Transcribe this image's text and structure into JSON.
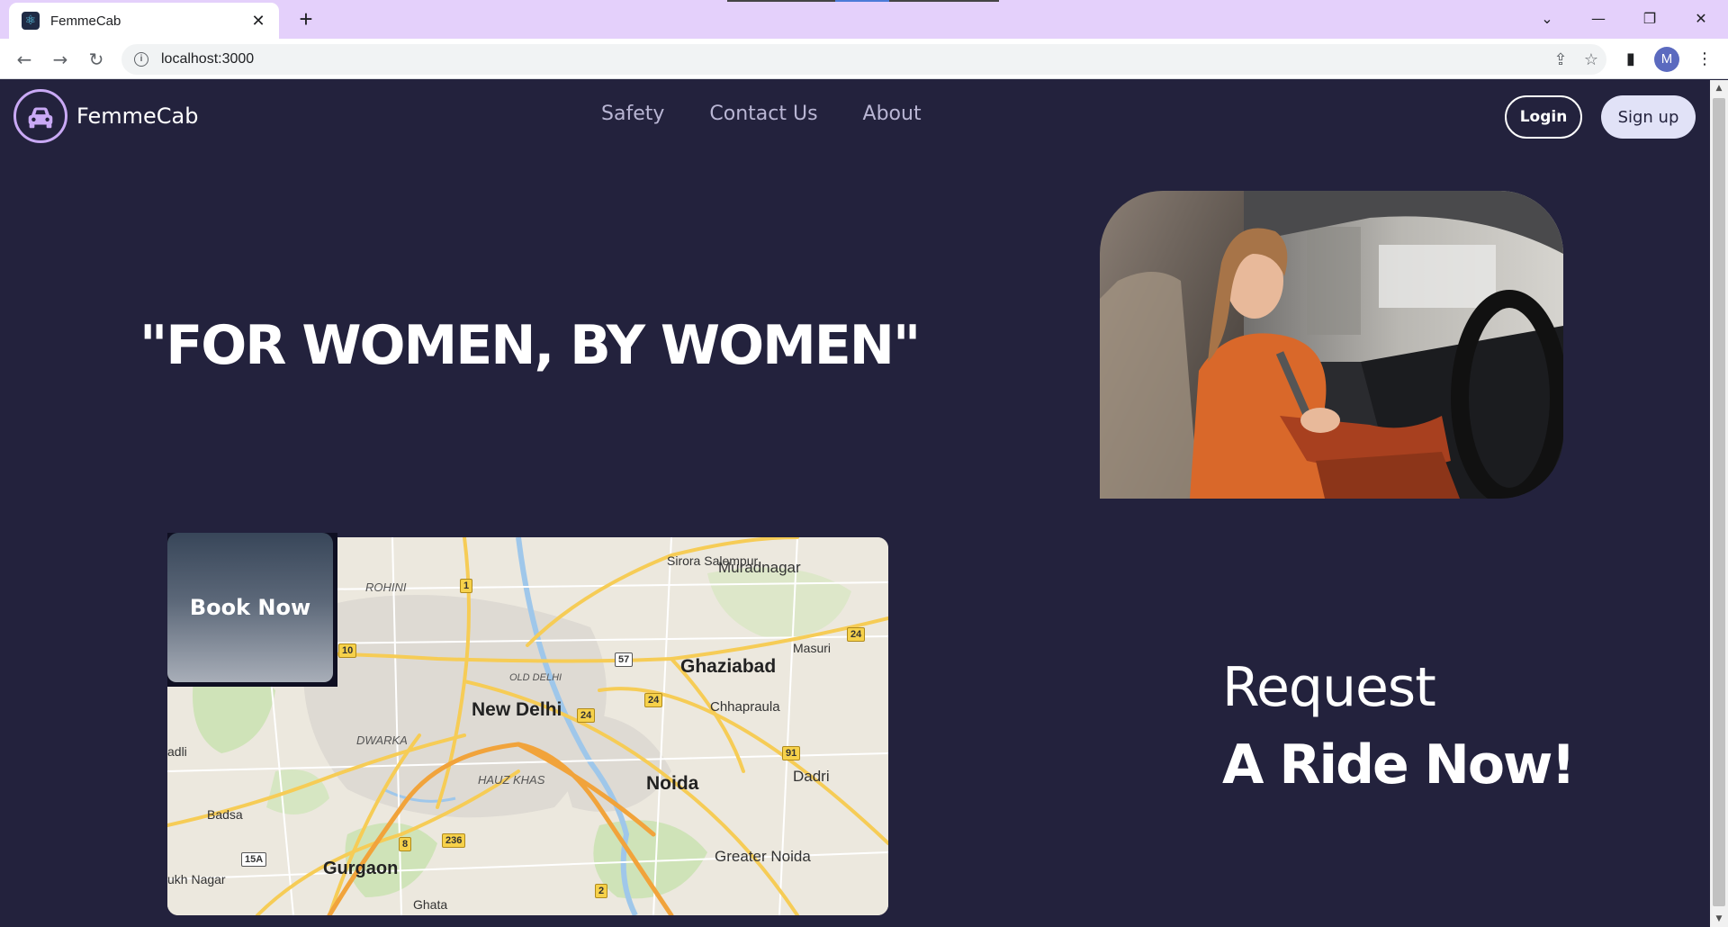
{
  "browser": {
    "tab_title": "FemmeCab",
    "tab_close": "✕",
    "new_tab": "+",
    "url": "localhost:3000",
    "profile_initial": "M",
    "controls": {
      "tab_search": "⌄",
      "minimize": "—",
      "restore": "❐",
      "close": "✕"
    }
  },
  "nav": {
    "brand": "FemmeCab",
    "links": [
      "Safety",
      "Contact Us",
      "About"
    ],
    "login": "Login",
    "signup": "Sign up"
  },
  "hero": {
    "tagline": "\"FOR WOMEN, BY WOMEN\""
  },
  "booking": {
    "button": "Book Now"
  },
  "map": {
    "places": [
      "ROHINI",
      "Sirora Salempur",
      "Muradnagar",
      "Masuri",
      "Ghaziabad",
      "OLD DELHI",
      "New Delhi",
      "Chhapraula",
      "DWARKA",
      "HAUZ KHAS",
      "adli",
      "Badsa",
      "Noida",
      "Dadri",
      "Greater Noida",
      "Gurgaon",
      "ukh Nagar",
      "Ghata"
    ],
    "route_shields": [
      "1",
      "10",
      "57",
      "24",
      "24",
      "24",
      "91",
      "8",
      "236",
      "15A",
      "2"
    ]
  },
  "cta": {
    "line1": "Request",
    "line2": "A Ride Now!"
  },
  "colors": {
    "page_bg": "#23223d",
    "accent_lilac": "#c9a9f5",
    "chrome_frame": "#e4d0fb",
    "signup_bg": "#e1e2f7"
  },
  "icons": {
    "logo": "car-icon",
    "back": "arrow-left-icon",
    "forward": "arrow-right-icon",
    "reload": "reload-icon",
    "site_info": "info-icon",
    "share": "share-icon",
    "bookmark": "star-icon",
    "side_panel": "side-panel-icon",
    "menu": "kebab-menu-icon"
  }
}
